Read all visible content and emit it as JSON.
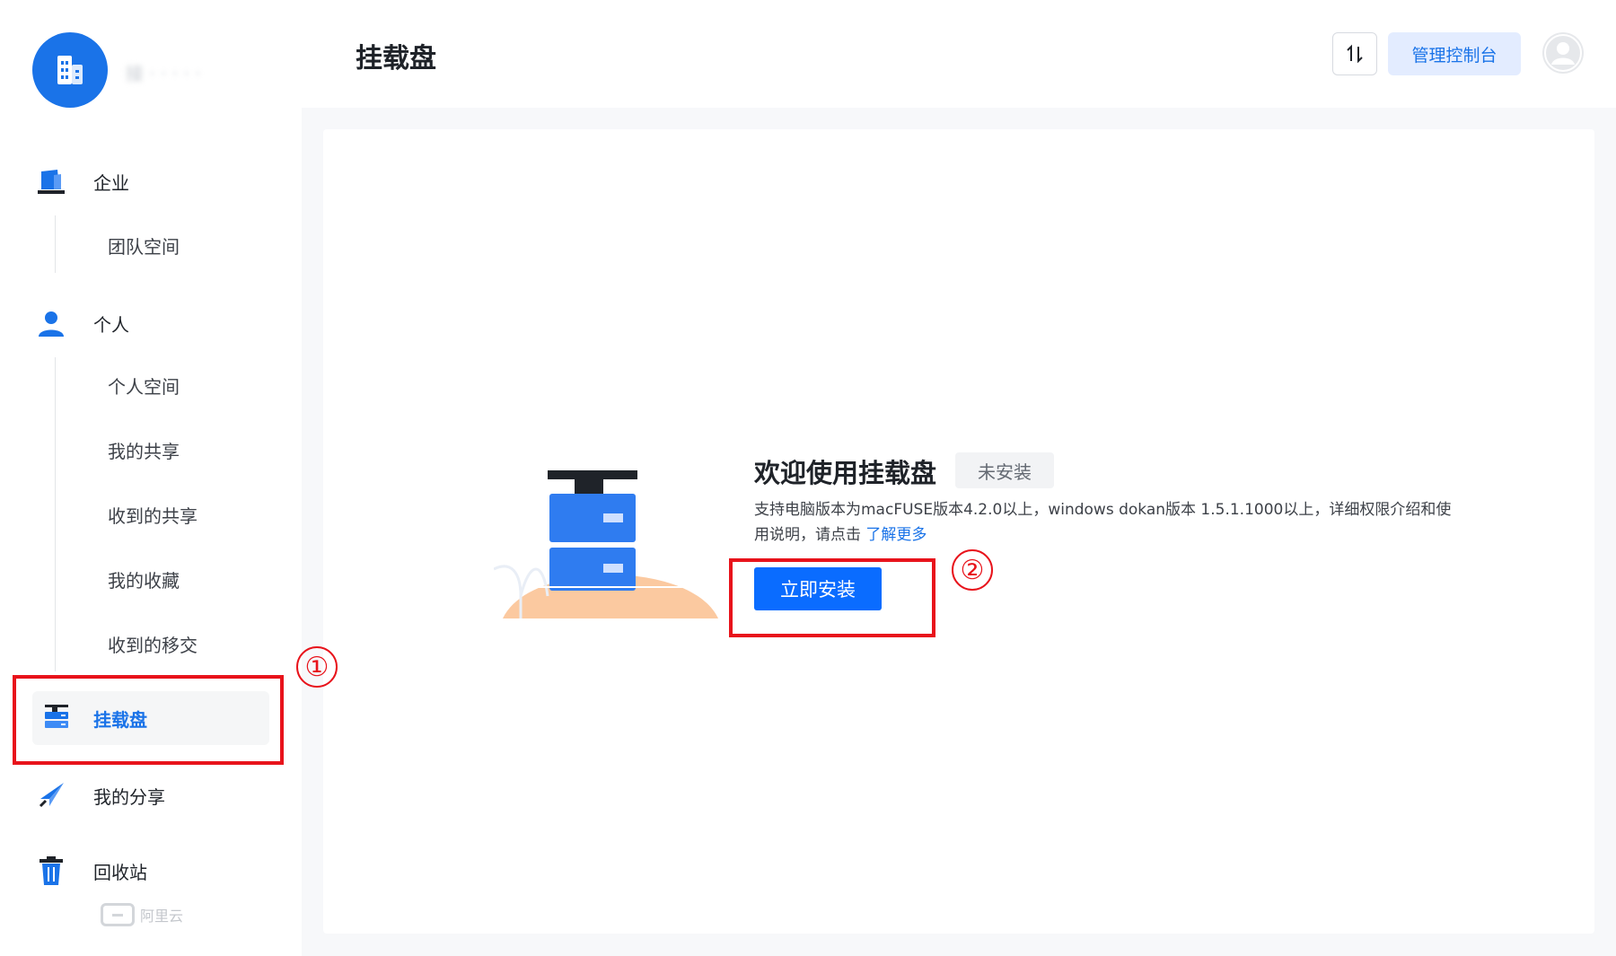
{
  "app": {
    "org_name": "接 · · · · ·",
    "brand_footer": "阿里云"
  },
  "sidebar": {
    "groups": [
      {
        "label": "企业",
        "icon": "building-icon",
        "items": [
          "团队空间"
        ]
      },
      {
        "label": "个人",
        "icon": "user-icon",
        "items": [
          "个人空间",
          "我的共享",
          "收到的共享",
          "我的收藏",
          "收到的移交"
        ]
      }
    ],
    "mount": {
      "label": "挂载盘",
      "icon": "server-icon",
      "active": true
    },
    "share": {
      "label": "我的分享",
      "icon": "paper-plane-icon"
    },
    "trash": {
      "label": "回收站",
      "icon": "trash-icon"
    }
  },
  "header": {
    "title": "挂载盘",
    "sort_icon": "sort-icon",
    "console_label": "管理控制台",
    "avatar_icon": "avatar-icon"
  },
  "main": {
    "welcome_title": "欢迎使用挂载盘",
    "status_tag": "未安装",
    "description": "支持电脑版本为macFUSE版本4.2.0以上，windows dokan版本 1.5.1.1000以上，详细权限介绍和使用说明，请点击 ",
    "learn_more": "了解更多",
    "install_label": "立即安装"
  },
  "annotations": {
    "step1": "①",
    "step2": "②",
    "color": "#e8131b"
  },
  "colors": {
    "accent": "#1a73e8",
    "primary_button": "#0a6cff",
    "console_bg": "#e3ecff"
  }
}
